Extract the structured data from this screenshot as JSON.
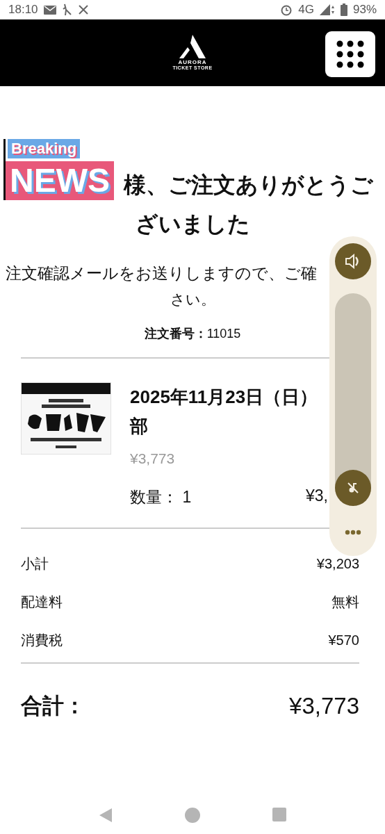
{
  "status_bar": {
    "time": "18:10",
    "network": "4G",
    "battery": "93%"
  },
  "header": {
    "logo": {
      "name": "AURORA",
      "subtitle": "TICKET STORE"
    }
  },
  "news_sticker": {
    "top": "Breaking",
    "bottom": "NEWS"
  },
  "confirmation": {
    "heading_lines": [
      "様、ご注文ありがとうご",
      "ざいました"
    ],
    "message_lines": [
      "注文確認メールをお送りしますので、ご確",
      "さい。"
    ],
    "order_number_label": "注文番号：",
    "order_number": "11015"
  },
  "item": {
    "image": {
      "kind": "picture"
    },
    "title_lines": [
      "2025年11月23日（日）",
      "部"
    ],
    "price": "¥3,773",
    "quantity_label": "数量：",
    "quantity": "1",
    "line_total": "¥3,"
  },
  "summary": [
    {
      "label": "小計",
      "value": "¥3,203"
    },
    {
      "label": "配達料",
      "value": "無料"
    },
    {
      "label": "消費税",
      "value": "¥570"
    }
  ],
  "total": {
    "label": "合計：",
    "value": "¥3,773"
  },
  "volume_panel": {
    "level": 0
  }
}
